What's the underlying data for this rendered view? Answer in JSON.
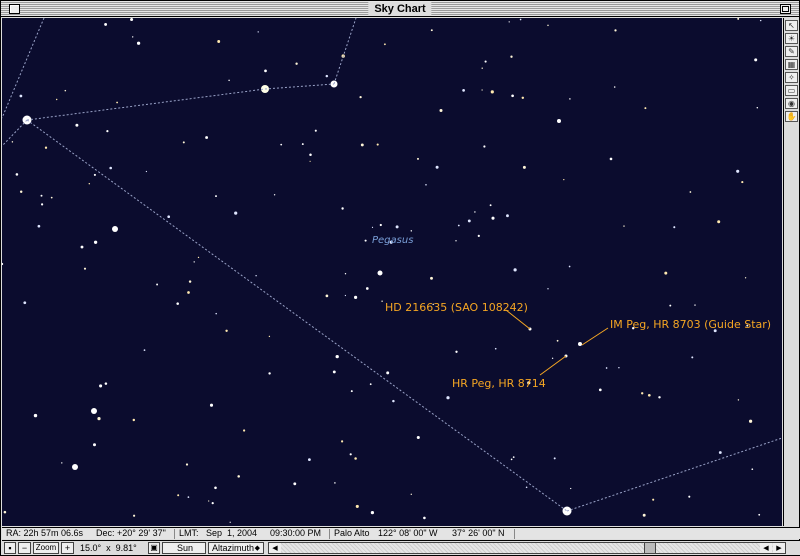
{
  "window": {
    "title": "Sky Chart"
  },
  "sky": {
    "background": "#0b0c2e",
    "label_color": "#f5a623",
    "constellation_line_color": "#9aa3c8",
    "constellation_name": "Pegasus",
    "labels": {
      "hd216635": "HD 216635 (SAO 108242)",
      "im_peg": "IM Peg, HR 8703 (Guide Star)",
      "hr_peg": "HR Peg, HR 8714"
    }
  },
  "sidebar": {
    "tools": [
      {
        "name": "pointer-tool-icon",
        "glyph": "↖"
      },
      {
        "name": "sun-tool-icon",
        "glyph": "☀"
      },
      {
        "name": "pencil-tool-icon",
        "glyph": "✎"
      },
      {
        "name": "grid-tool-icon",
        "glyph": "▦"
      },
      {
        "name": "constellation-tool-icon",
        "glyph": "✧"
      },
      {
        "name": "window-tool-icon",
        "glyph": "▭"
      },
      {
        "name": "globe-tool-icon",
        "glyph": "◉"
      },
      {
        "name": "hand-tool-icon",
        "glyph": "✋"
      }
    ]
  },
  "status": {
    "ra": "RA: 22h 57m 06.6s",
    "dec": "Dec: +20° 29' 37\"",
    "lmt_label": "LMT:",
    "date": "Sep  1, 2004",
    "time": "09:30:00 PM",
    "location": "Palo Alto",
    "longitude": "122° 08' 00\" W",
    "latitude": "37° 26' 00\" N"
  },
  "controls": {
    "zoom_label": "Zoom",
    "field_of_view": "15.0°  x  9.81°",
    "center_object": "Sun",
    "projection": "Altazimuth"
  }
}
